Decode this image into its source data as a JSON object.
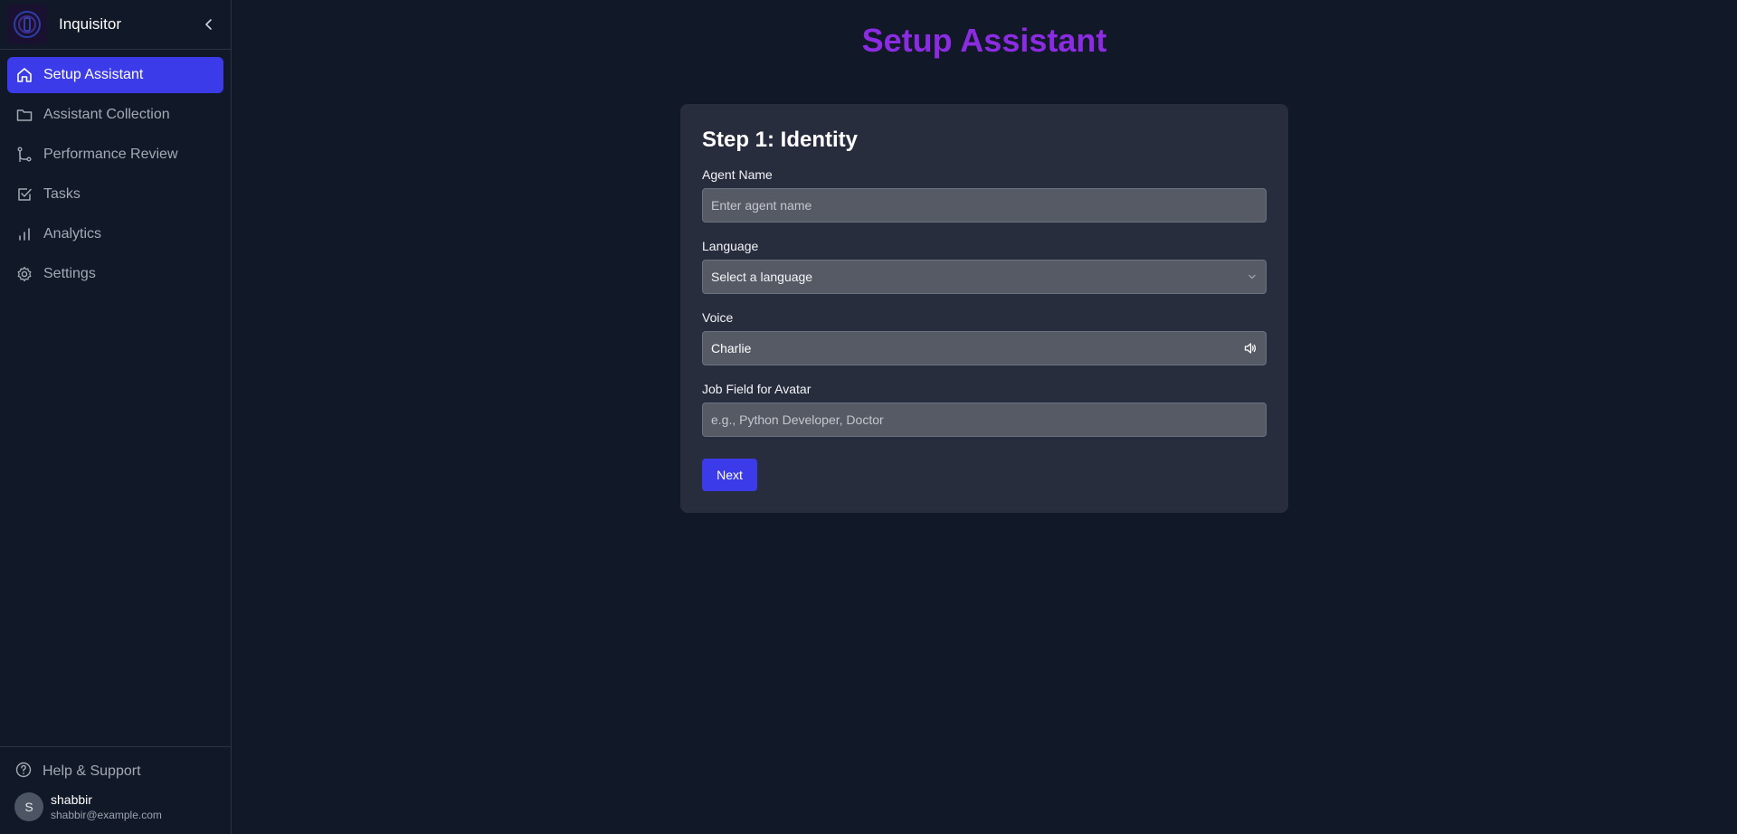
{
  "app": {
    "name": "Inquisitor"
  },
  "sidebar": {
    "items": [
      {
        "label": "Setup Assistant",
        "icon": "home-icon",
        "active": true
      },
      {
        "label": "Assistant Collection",
        "icon": "folder-icon",
        "active": false
      },
      {
        "label": "Performance Review",
        "icon": "git-branch-icon",
        "active": false
      },
      {
        "label": "Tasks",
        "icon": "check-square-icon",
        "active": false
      },
      {
        "label": "Analytics",
        "icon": "bar-chart-icon",
        "active": false
      },
      {
        "label": "Settings",
        "icon": "gear-icon",
        "active": false
      }
    ],
    "help_label": "Help & Support",
    "user": {
      "initial": "S",
      "name": "shabbir",
      "email": "shabbir@example.com"
    }
  },
  "main": {
    "title": "Setup Assistant",
    "card": {
      "title": "Step 1: Identity",
      "agent_name": {
        "label": "Agent Name",
        "placeholder": "Enter agent name",
        "value": ""
      },
      "language": {
        "label": "Language",
        "selected": "Select a language"
      },
      "voice": {
        "label": "Voice",
        "value": "Charlie"
      },
      "job_field": {
        "label": "Job Field for Avatar",
        "placeholder": "e.g., Python Developer, Doctor",
        "value": ""
      },
      "next_label": "Next"
    }
  },
  "colors": {
    "background": "#111827",
    "accent": "#3b3bea",
    "title": "#8b2be2",
    "card": "#282d3e",
    "input": "#565a65"
  }
}
